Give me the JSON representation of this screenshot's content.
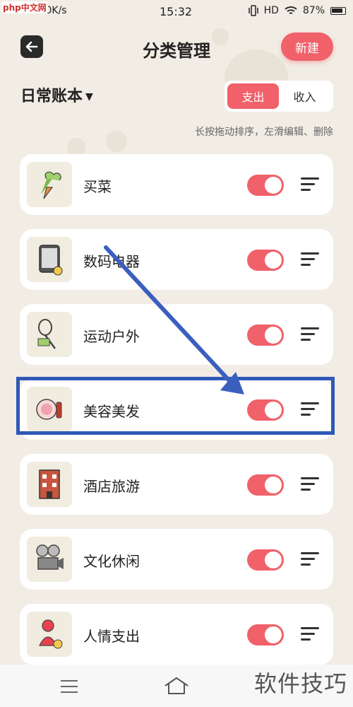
{
  "status_bar": {
    "logo": "php中文网",
    "left": "4G+ .ıll 0K/s",
    "time": "15:32",
    "hd": "HD",
    "battery": "87%"
  },
  "header": {
    "title": "分类管理",
    "new_label": "新建"
  },
  "book": {
    "name": "日常账本"
  },
  "tabs": [
    {
      "label": "支出",
      "active": true
    },
    {
      "label": "收入",
      "active": false
    }
  ],
  "hint": "长按拖动排序，左滑编辑、删除",
  "categories": [
    {
      "label": "买菜",
      "icon": "vegetables-icon",
      "enabled": true
    },
    {
      "label": "数码电器",
      "icon": "tablet-icon",
      "enabled": true
    },
    {
      "label": "运动户外",
      "icon": "racket-icon",
      "enabled": true
    },
    {
      "label": "美容美发",
      "icon": "cosmetics-icon",
      "enabled": true
    },
    {
      "label": "酒店旅游",
      "icon": "hotel-icon",
      "enabled": true
    },
    {
      "label": "文化休闲",
      "icon": "film-camera-icon",
      "enabled": true
    },
    {
      "label": "人情支出",
      "icon": "person-coin-icon",
      "enabled": true
    }
  ],
  "annotation": {
    "highlight_color": "#2e59b7",
    "highlighted_item": "美容美发"
  },
  "colors": {
    "accent": "#f0616a",
    "background": "#f1ece4"
  },
  "watermark": "软件技巧"
}
